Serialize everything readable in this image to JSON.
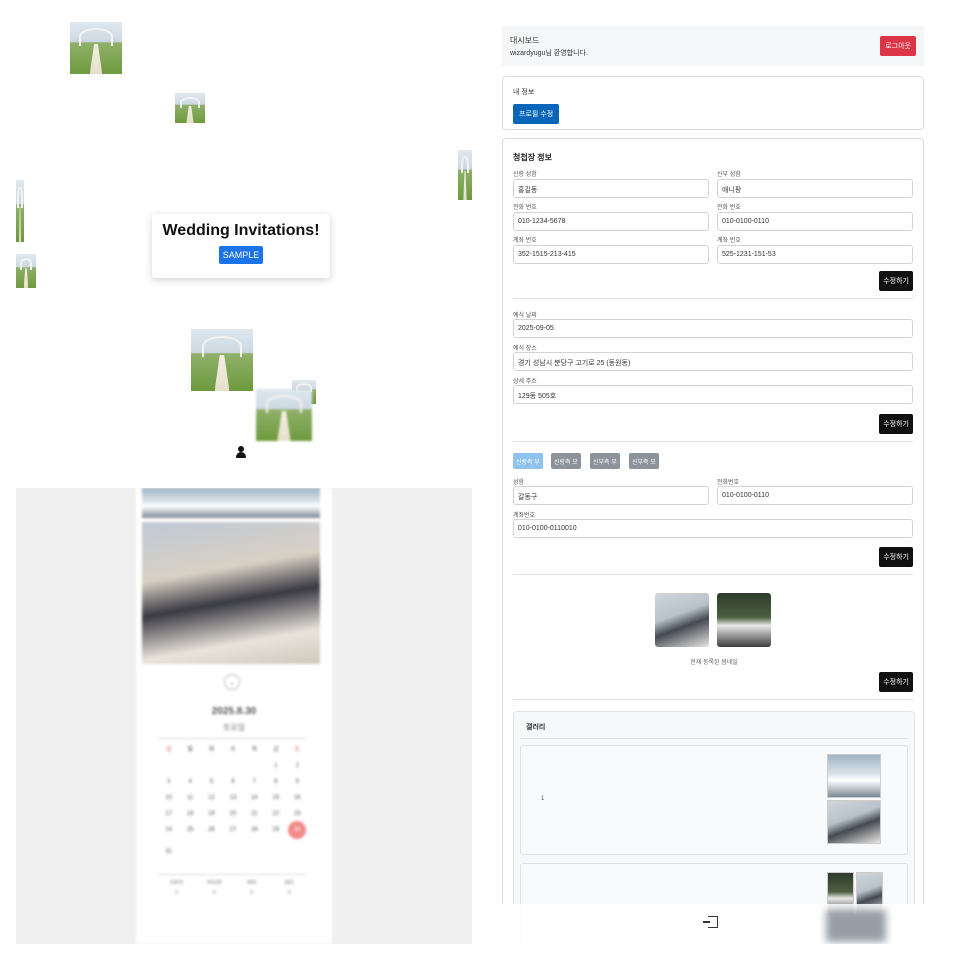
{
  "preview": {
    "title": "Wedding Invitations!",
    "sample_button": "SAMPLE",
    "date": "2025.8.30",
    "weekday": "토요일",
    "weekdays": [
      "일",
      "월",
      "화",
      "수",
      "목",
      "금",
      "토"
    ],
    "calendar_days": [
      "",
      "",
      "",
      "",
      "",
      "1",
      "2",
      "3",
      "4",
      "5",
      "6",
      "7",
      "8",
      "9",
      "10",
      "11",
      "12",
      "13",
      "14",
      "15",
      "16",
      "17",
      "18",
      "19",
      "20",
      "21",
      "22",
      "23",
      "24",
      "25",
      "26",
      "27",
      "28",
      "29",
      "30",
      "31"
    ],
    "selected_day": "30",
    "countdown_labels": [
      "DAYS",
      "HOUR",
      "MIN",
      "SEC"
    ],
    "countdown_values": [
      "0",
      "0",
      "0",
      "0"
    ]
  },
  "header": {
    "title": "대시보드",
    "welcome": "wizardyugu님 환영합니다.",
    "logout": "로그아웃"
  },
  "profile": {
    "label": "내 정보",
    "edit_button": "프로필 수정"
  },
  "invitation": {
    "section_title": "청첩장 정보",
    "groom_name_label": "신랑 성함",
    "groom_name": "홍길동",
    "bride_name_label": "신부 성함",
    "bride_name": "애니팡",
    "groom_phone_label": "전화 번호",
    "groom_phone": "010-1234-5678",
    "bride_phone_label": "전화 번호",
    "bride_phone": "010-0100-0110",
    "groom_account_label": "계좌 번호",
    "groom_account": "352-1515-213-415",
    "bride_account_label": "계좌 번호",
    "bride_account": "525-1231-151-53",
    "save1": "수정하기",
    "date_label": "예식 날짜",
    "date": "2025-09-05",
    "venue_label": "예식 장소",
    "venue": "경기 성남시 분당구 고기로 25 (동원동)",
    "address_label": "상세 주소",
    "address": "129동 505호",
    "save2": "수정하기",
    "tabs": [
      "신랑측 부",
      "신랑측 모",
      "신부측 부",
      "신부측 모"
    ],
    "parent_name_label": "성함",
    "parent_name": "갈동구",
    "parent_phone_label": "전화번호",
    "parent_phone": "010-0100-0110",
    "parent_account_label": "계좌번호",
    "parent_account": "010-0100-0110010",
    "save3": "수정하기",
    "photo_caption": "현재 등록된 썸네일",
    "save4": "수정하기"
  },
  "gallery": {
    "title": "갤러리",
    "items": [
      {
        "number": "1"
      }
    ]
  }
}
